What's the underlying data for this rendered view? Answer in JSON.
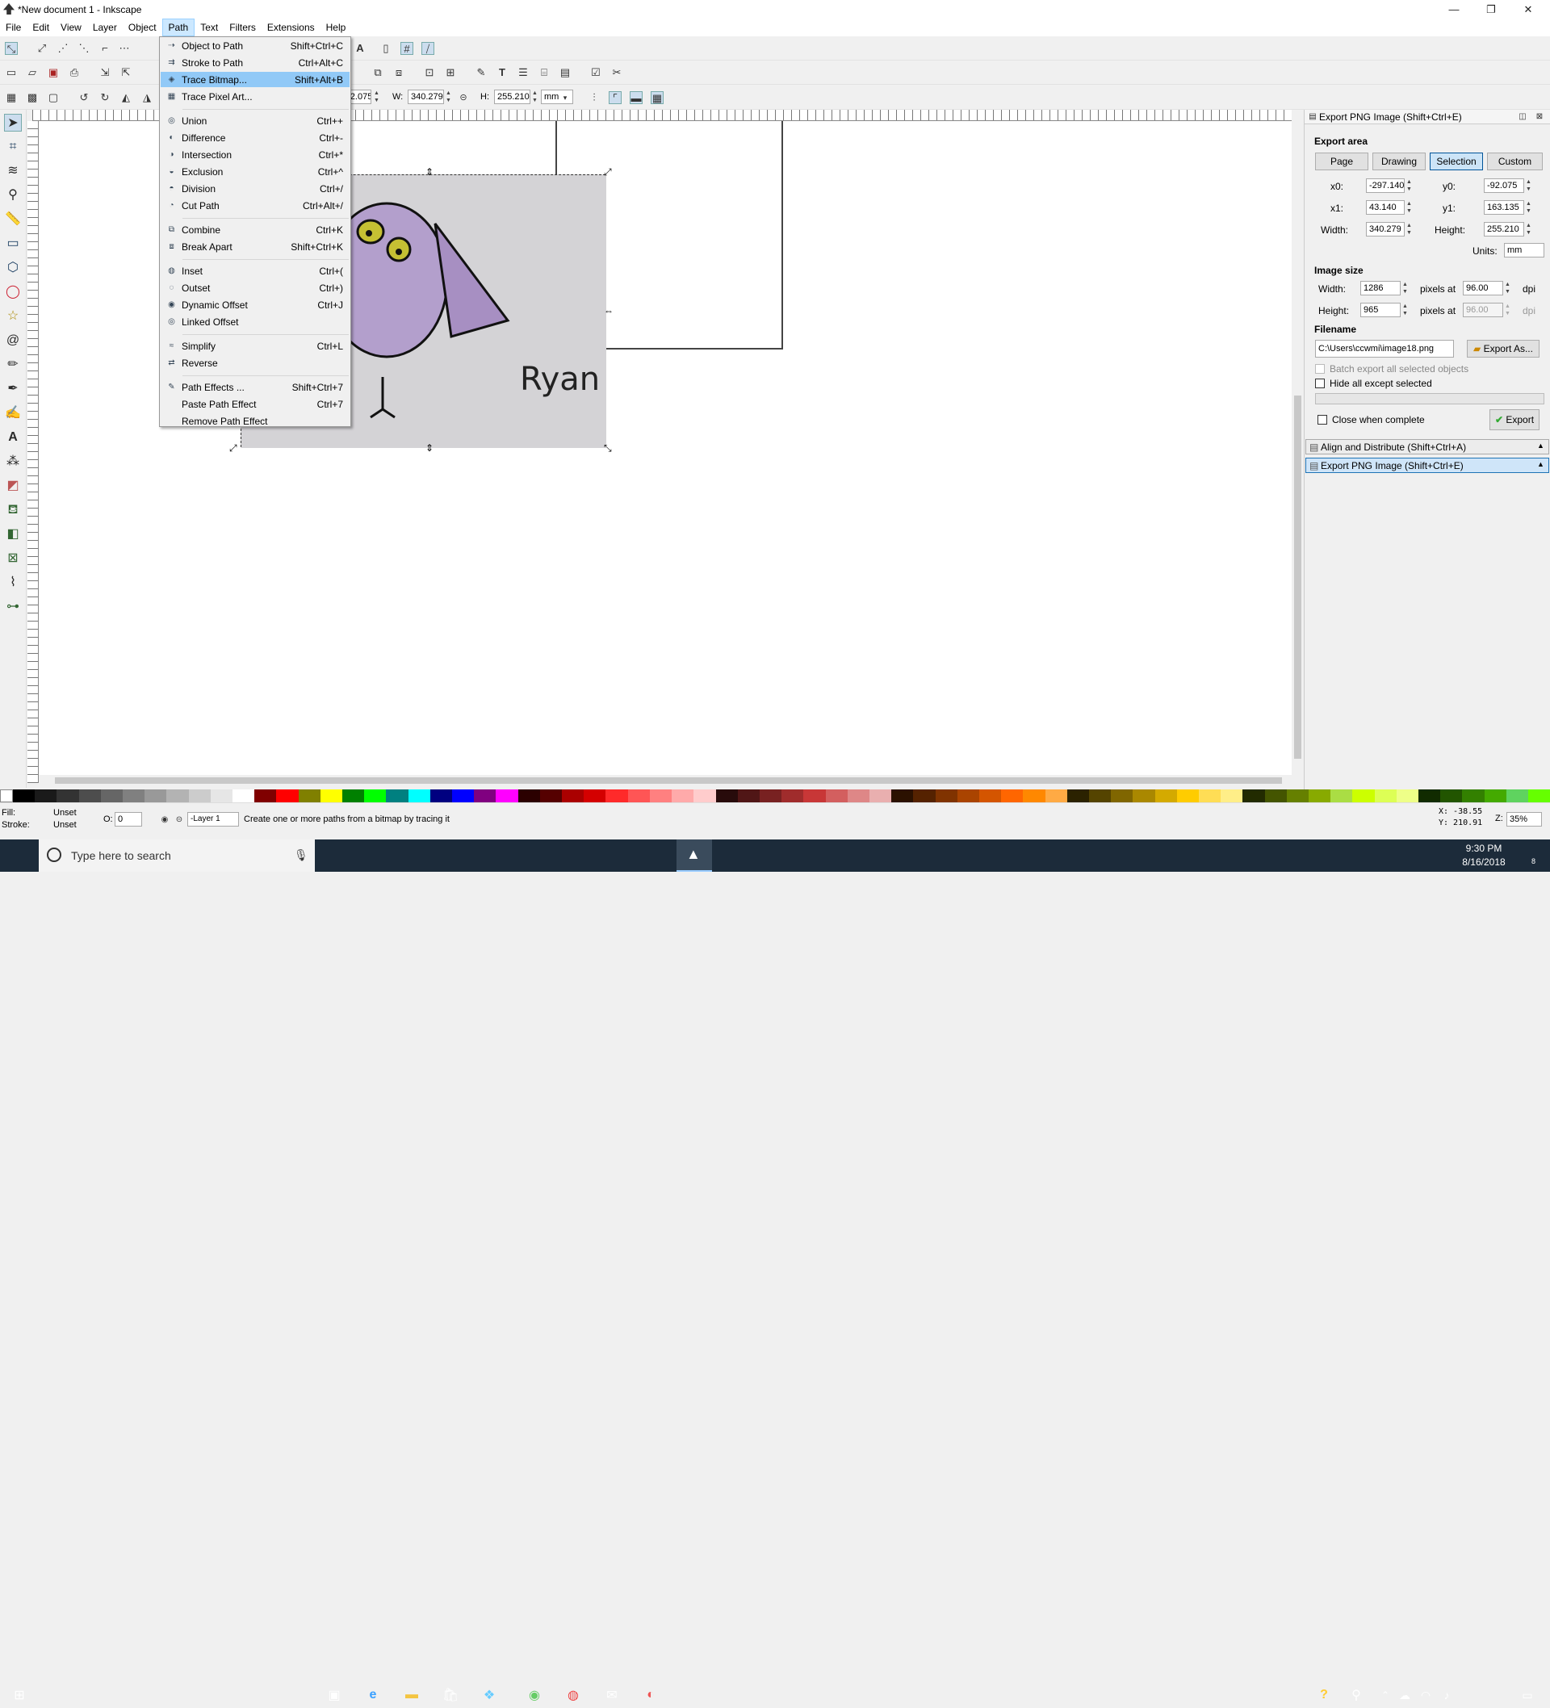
{
  "window": {
    "title": "*New document 1 - Inkscape",
    "controls": [
      "—",
      "❐",
      "✕"
    ]
  },
  "menubar": [
    "File",
    "Edit",
    "View",
    "Layer",
    "Object",
    "Path",
    "Text",
    "Filters",
    "Extensions",
    "Help"
  ],
  "path_menu": {
    "items": [
      {
        "label": "Object to Path",
        "shortcut": "Shift+Ctrl+C",
        "icon": "object-to-path-icon"
      },
      {
        "label": "Stroke to Path",
        "shortcut": "Ctrl+Alt+C",
        "icon": "stroke-to-path-icon"
      },
      {
        "label": "Trace Bitmap...",
        "shortcut": "Shift+Alt+B",
        "icon": "trace-bitmap-icon",
        "highlighted": true
      },
      {
        "label": "Trace Pixel Art...",
        "shortcut": "",
        "icon": "trace-pixel-art-icon"
      },
      {
        "label": "Union",
        "shortcut": "Ctrl++",
        "icon": "union-icon"
      },
      {
        "label": "Difference",
        "shortcut": "Ctrl+-",
        "icon": "difference-icon"
      },
      {
        "label": "Intersection",
        "shortcut": "Ctrl+*",
        "icon": "intersection-icon"
      },
      {
        "label": "Exclusion",
        "shortcut": "Ctrl+^",
        "icon": "exclusion-icon"
      },
      {
        "label": "Division",
        "shortcut": "Ctrl+/",
        "icon": "division-icon"
      },
      {
        "label": "Cut Path",
        "shortcut": "Ctrl+Alt+/",
        "icon": "cut-path-icon"
      },
      {
        "label": "Combine",
        "shortcut": "Ctrl+K",
        "icon": "combine-icon"
      },
      {
        "label": "Break Apart",
        "shortcut": "Shift+Ctrl+K",
        "icon": "break-apart-icon"
      },
      {
        "label": "Inset",
        "shortcut": "Ctrl+(",
        "icon": "inset-icon"
      },
      {
        "label": "Outset",
        "shortcut": "Ctrl+)",
        "icon": "outset-icon"
      },
      {
        "label": "Dynamic Offset",
        "shortcut": "Ctrl+J",
        "icon": "dynamic-offset-icon"
      },
      {
        "label": "Linked Offset",
        "shortcut": "",
        "icon": "linked-offset-icon"
      },
      {
        "label": "Simplify",
        "shortcut": "Ctrl+L",
        "icon": "simplify-icon"
      },
      {
        "label": "Reverse",
        "shortcut": "",
        "icon": "reverse-icon"
      },
      {
        "label": "Path Effects ...",
        "shortcut": "Shift+Ctrl+7",
        "icon": "path-effects-icon"
      },
      {
        "label": "Paste Path Effect",
        "shortcut": "Ctrl+7",
        "icon": ""
      },
      {
        "label": "Remove Path Effect",
        "shortcut": "",
        "icon": ""
      }
    ]
  },
  "toolbar": {
    "y": "-92.075",
    "w_label": "W:",
    "w": "340.279",
    "h_label": "H:",
    "h": "255.210",
    "unit": "mm"
  },
  "canvas": {
    "drawing_text": "Ryan"
  },
  "export_panel": {
    "title": "Export PNG Image (Shift+Ctrl+E)",
    "export_area": "Export area",
    "tabs": [
      "Page",
      "Drawing",
      "Selection",
      "Custom"
    ],
    "selected_tab": "Selection",
    "x0_label": "x0:",
    "x0": "-297.140",
    "y0_label": "y0:",
    "y0": "-92.075",
    "x1_label": "x1:",
    "x1": "43.140",
    "y1_label": "y1:",
    "y1": "163.135",
    "width_label": "Width:",
    "width": "340.279",
    "height_label": "Height:",
    "height": "255.210",
    "units_label": "Units:",
    "units": "mm",
    "image_size": "Image size",
    "img_width_label": "Width:",
    "img_width": "1286",
    "pixels_at": "pixels at",
    "dpi_x": "96.00",
    "dpi": "dpi",
    "img_height_label": "Height:",
    "img_height": "965",
    "dpi_y": "96.00",
    "filename_label": "Filename",
    "filename": "C:\\Users\\ccwmi\\image18.png",
    "export_as": "Export As...",
    "batch": "Batch export all selected objects",
    "hide_all": "Hide all except selected",
    "close_when": "Close when complete",
    "export_button": "Export",
    "docked": [
      "Align and Distribute (Shift+Ctrl+A)",
      "Export PNG Image (Shift+Ctrl+E)"
    ]
  },
  "status": {
    "fill_label": "Fill:",
    "fill": "Unset",
    "stroke_label": "Stroke:",
    "stroke": "Unset",
    "opacity_label": "O:",
    "opacity": "0",
    "layer": "-Layer 1",
    "message": "Create one or more paths from a bitmap by tracing it",
    "cursor_x": "X: -38.55",
    "cursor_y": "Y: 210.91",
    "zoom_label": "Z:",
    "zoom": "35%"
  },
  "taskbar": {
    "search_placeholder": "Type here to search",
    "time": "9:30 PM",
    "date": "8/16/2018",
    "notification_count": "8"
  }
}
